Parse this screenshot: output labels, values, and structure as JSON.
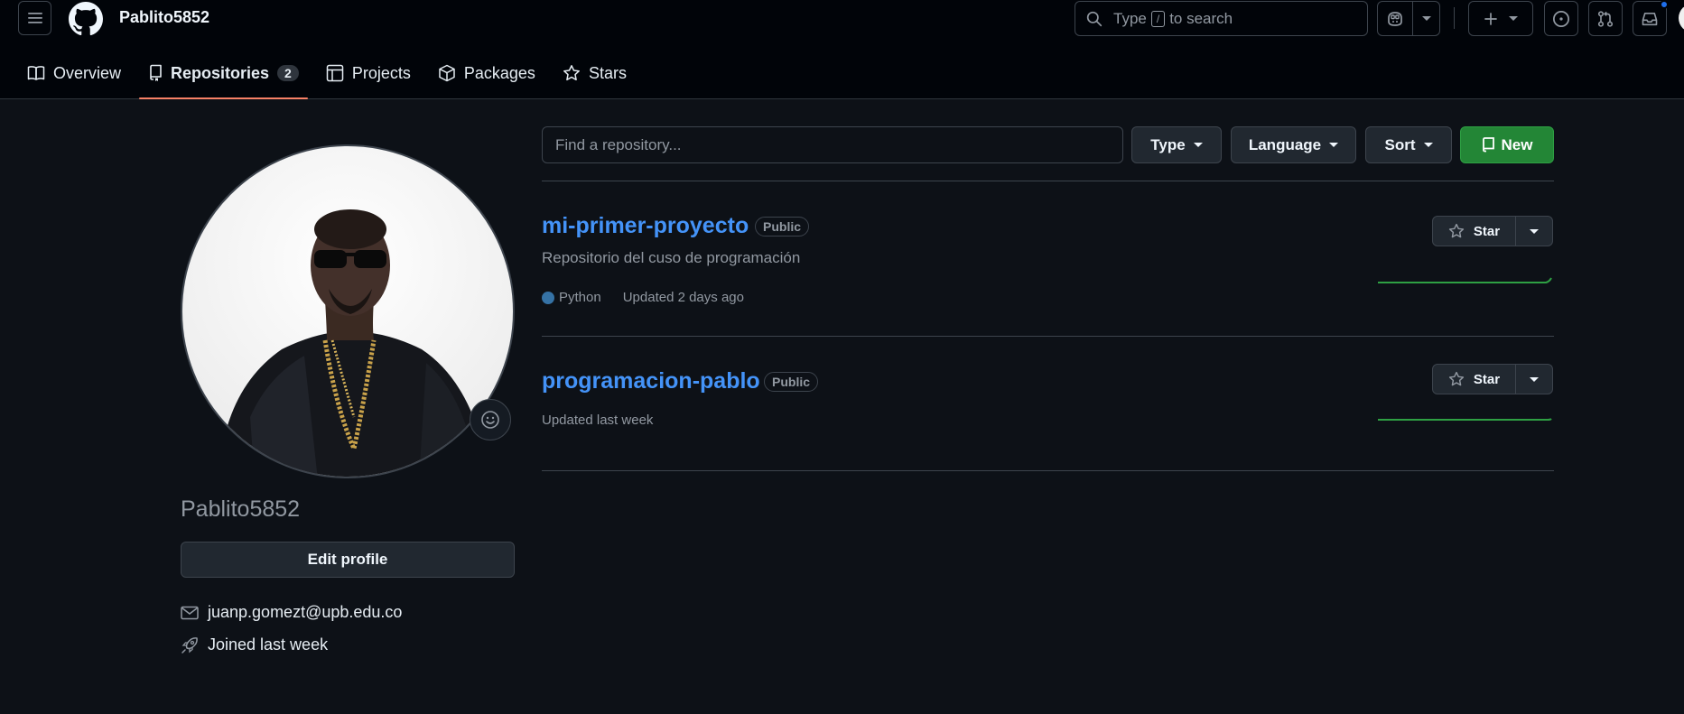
{
  "header": {
    "username": "Pablito5852",
    "search": {
      "prefix": "Type",
      "key": "/",
      "suffix": "to search"
    }
  },
  "tabs": [
    {
      "label": "Overview"
    },
    {
      "label": "Repositories",
      "count": "2"
    },
    {
      "label": "Projects"
    },
    {
      "label": "Packages"
    },
    {
      "label": "Stars"
    }
  ],
  "profile": {
    "name": "Pablito5852",
    "edit_label": "Edit profile",
    "email": "juanp.gomezt@upb.edu.co",
    "joined": "Joined last week"
  },
  "repo_controls": {
    "search_placeholder": "Find a repository...",
    "type_label": "Type",
    "language_label": "Language",
    "sort_label": "Sort",
    "new_label": "New"
  },
  "repos": [
    {
      "name": "mi-primer-proyecto",
      "visibility": "Public",
      "description": "Repositorio del cuso de programación",
      "language": "Python",
      "language_color": "#3572A5",
      "updated": "Updated 2 days ago",
      "star_label": "Star"
    },
    {
      "name": "programacion-pablo",
      "visibility": "Public",
      "updated": "Updated last week",
      "star_label": "Star"
    }
  ],
  "colors": {
    "background": "#0d1117",
    "header": "#010409",
    "accent_link": "#4493f8",
    "new_button": "#238636",
    "active_tab_underline": "#f78166"
  }
}
